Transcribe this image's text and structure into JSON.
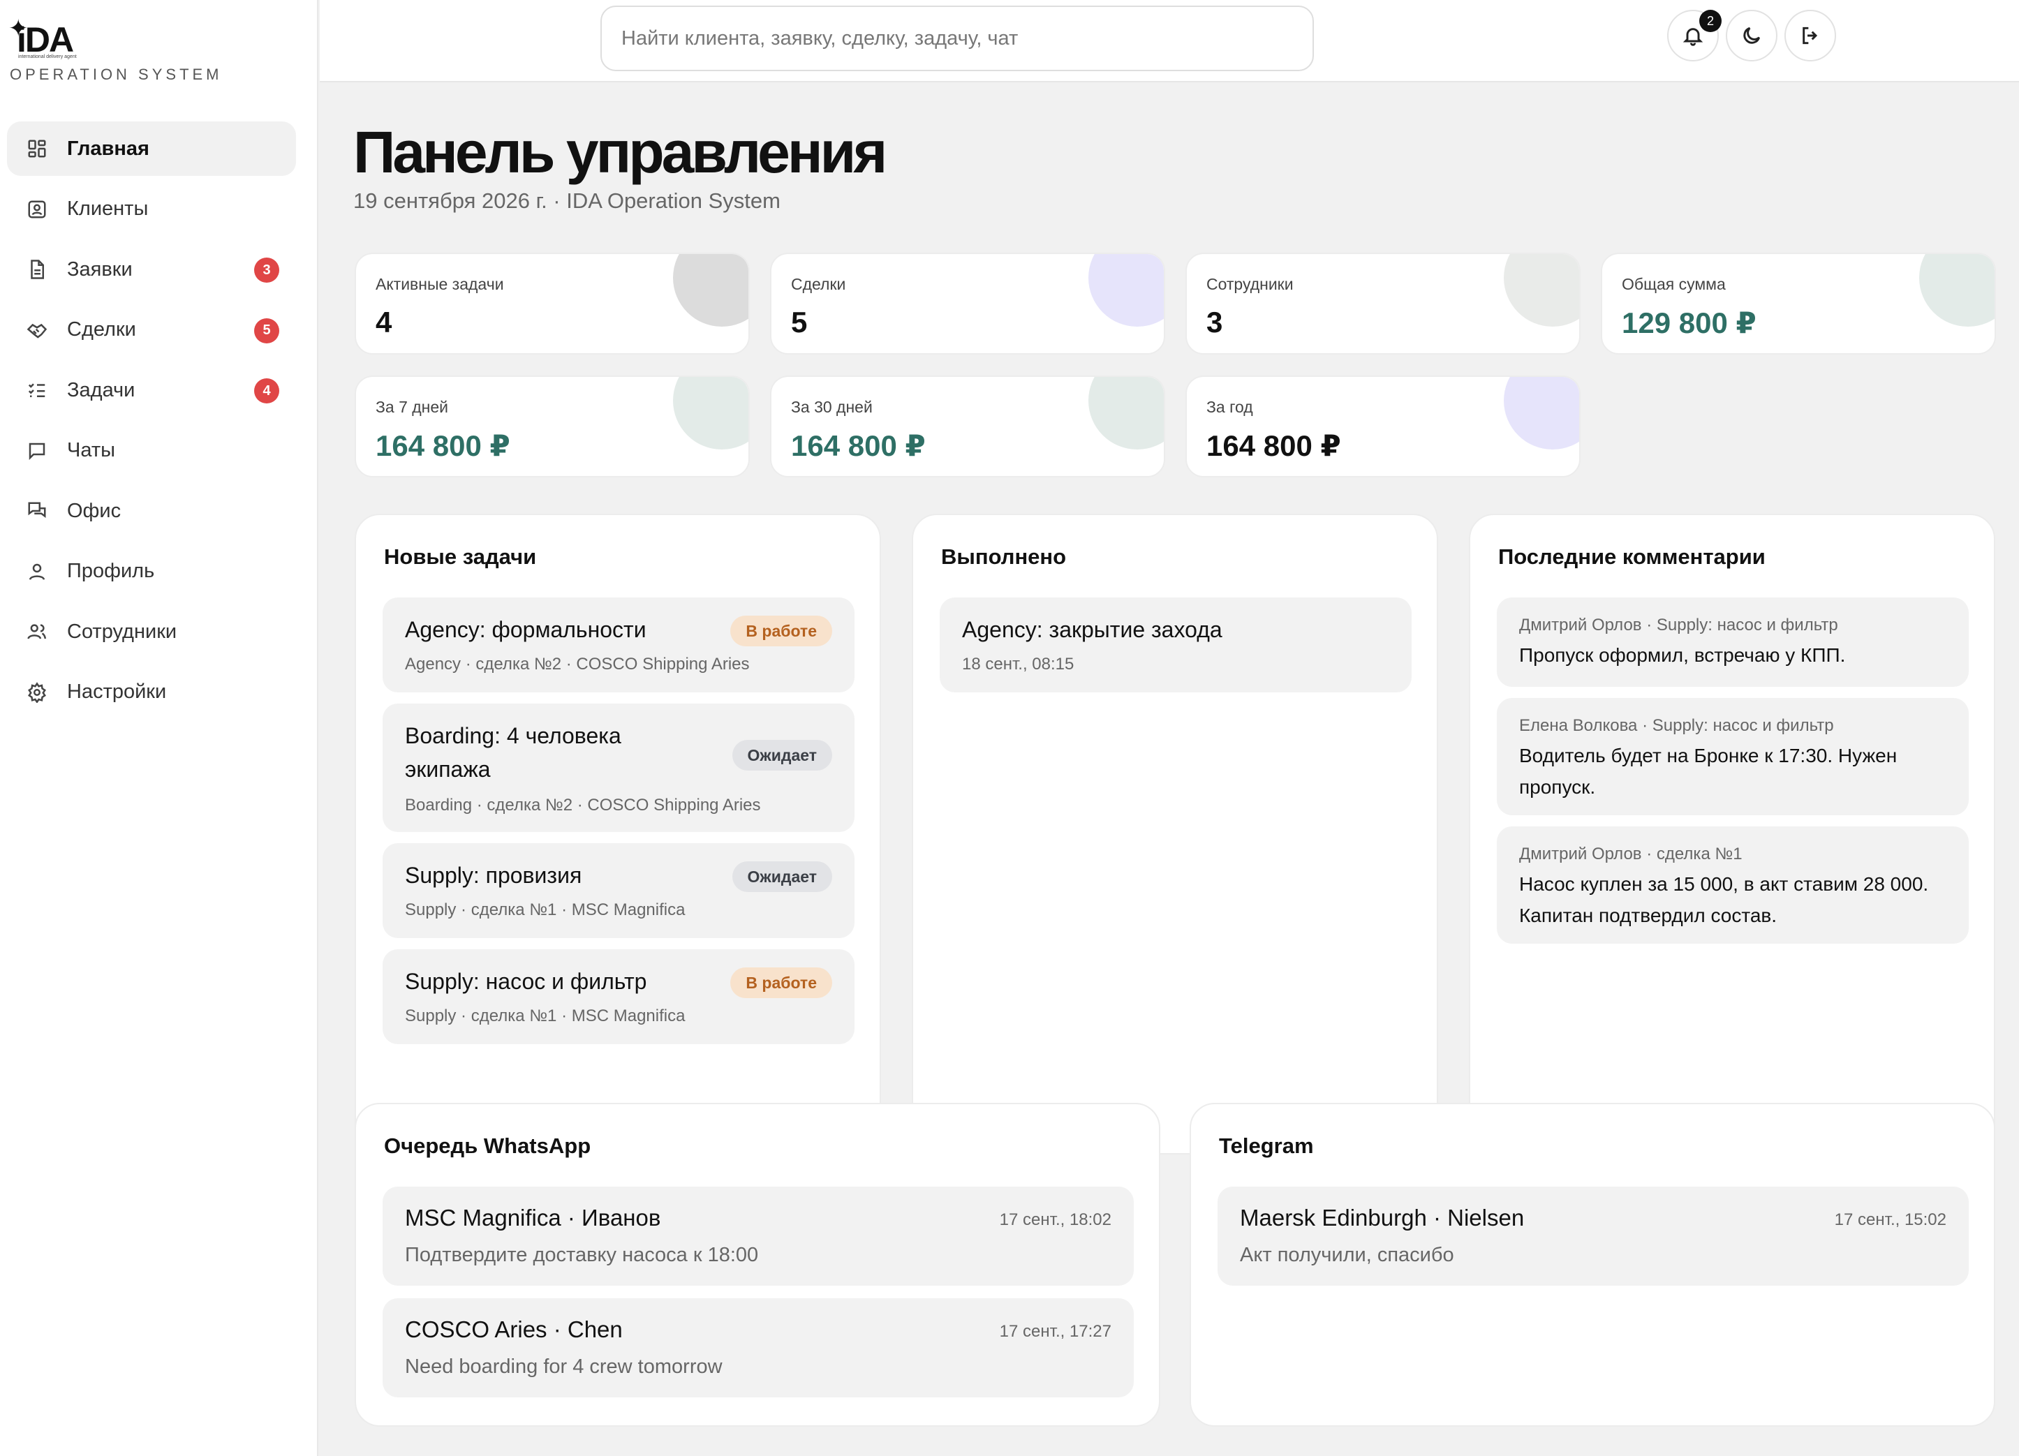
{
  "brand": {
    "logo_text": "iDA",
    "logo_sub": "international delivery agent",
    "subtitle": "OPERATION SYSTEM"
  },
  "sidebar": {
    "items": [
      {
        "label": "Главная",
        "icon": "dashboard-icon",
        "active": true,
        "badge": null
      },
      {
        "label": "Клиенты",
        "icon": "contact-card-icon",
        "active": false,
        "badge": null
      },
      {
        "label": "Заявки",
        "icon": "document-icon",
        "active": false,
        "badge": "3"
      },
      {
        "label": "Сделки",
        "icon": "handshake-icon",
        "active": false,
        "badge": "5"
      },
      {
        "label": "Задачи",
        "icon": "checklist-icon",
        "active": false,
        "badge": "4"
      },
      {
        "label": "Чаты",
        "icon": "chat-icon",
        "active": false,
        "badge": null
      },
      {
        "label": "Офис",
        "icon": "office-chat-icon",
        "active": false,
        "badge": null
      },
      {
        "label": "Профиль",
        "icon": "user-icon",
        "active": false,
        "badge": null
      },
      {
        "label": "Сотрудники",
        "icon": "users-icon",
        "active": false,
        "badge": null
      },
      {
        "label": "Настройки",
        "icon": "gear-icon",
        "active": false,
        "badge": null
      }
    ]
  },
  "header": {
    "search_placeholder": "Найти клиента, заявку, сделку, задачу, чат",
    "notifications_count": "2"
  },
  "page": {
    "title": "Панель управления",
    "subtitle": "19 сентября 2026 г. · IDA Operation System"
  },
  "stats": [
    {
      "label": "Активные задачи",
      "value": "4",
      "accent": false,
      "blob_color": "#dcdcdc"
    },
    {
      "label": "Сделки",
      "value": "5",
      "accent": false,
      "blob_color": "#e6e4fb"
    },
    {
      "label": "Сотрудники",
      "value": "3",
      "accent": false,
      "blob_color": "#e9ebe9"
    },
    {
      "label": "Общая сумма",
      "value": "129 800 ₽",
      "accent": true,
      "blob_color": "#e3ebe8"
    },
    {
      "label": "За 7 дней",
      "value": "164 800 ₽",
      "accent": true,
      "blob_color": "#e3ebe8"
    },
    {
      "label": "За 30 дней",
      "value": "164 800 ₽",
      "accent": true,
      "blob_color": "#e3ebe8"
    },
    {
      "label": "За год",
      "value": "164 800 ₽",
      "accent": false,
      "blob_color": "#e6e4fb"
    }
  ],
  "new_tasks": {
    "title": "Новые задачи",
    "items": [
      {
        "title_lines": [
          "Agency: формальности"
        ],
        "meta": "Agency · сделка №2 · COSCO Shipping Aries",
        "status": "В работе",
        "status_kind": "work"
      },
      {
        "title_lines": [
          "Boarding: 4 человека",
          "экипажа"
        ],
        "meta": "Boarding · сделка №2 · COSCO Shipping Aries",
        "status": "Ожидает",
        "status_kind": "wait"
      },
      {
        "title_lines": [
          "Supply: провизия"
        ],
        "meta": "Supply · сделка №1 · MSC Magnifica",
        "status": "Ожидает",
        "status_kind": "wait"
      },
      {
        "title_lines": [
          "Supply: насос и фильтр"
        ],
        "meta": "Supply · сделка №1 · MSC Magnifica",
        "status": "В работе",
        "status_kind": "work"
      }
    ]
  },
  "done": {
    "title": "Выполнено",
    "items": [
      {
        "title": "Agency: закрытие захода",
        "meta": "18 сент., 08:15"
      }
    ]
  },
  "comments": {
    "title": "Последние комментарии",
    "items": [
      {
        "author": "Дмитрий Орлов · Supply: насос и фильтр",
        "text": "Пропуск оформил, встречаю у КПП."
      },
      {
        "author": "Елена Волкова · Supply: насос и фильтр",
        "text": "Водитель будет на Бронке к 17:30. Нужен пропуск."
      },
      {
        "author": "Дмитрий Орлов · сделка №1",
        "text": "Насос куплен за 15 000, в акт ставим 28 000. Капитан подтвердил состав."
      }
    ]
  },
  "whatsapp": {
    "title": "Очередь WhatsApp",
    "items": [
      {
        "name": "MSC Magnifica · Иванов",
        "time": "17 сент., 18:02",
        "text": "Подтвердите доставку насоса к 18:00"
      },
      {
        "name": "COSCO Aries · Chen",
        "time": "17 сент., 17:27",
        "text": "Need boarding for 4 crew tomorrow"
      }
    ]
  },
  "telegram": {
    "title": "Telegram",
    "items": [
      {
        "name": "Maersk Edinburgh · Nielsen",
        "time": "17 сент., 15:02",
        "text": "Акт получили, спасибо"
      }
    ]
  },
  "colors": {
    "accent_green": "#2e6f65",
    "badge_red": "#e04646",
    "status_work_bg": "#f8e2cc",
    "status_work_fg": "#b4611f",
    "status_wait_bg": "#e2e3e6"
  }
}
